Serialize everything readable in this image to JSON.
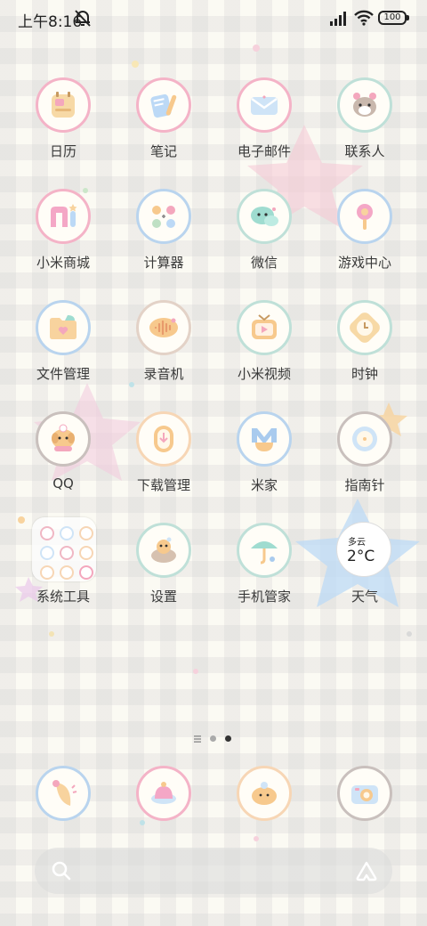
{
  "status_bar": {
    "time": "上午8:16",
    "battery": "100",
    "icons": [
      "silent-bell-icon",
      "signal-icon",
      "wifi-icon",
      "battery-icon"
    ]
  },
  "apps": [
    {
      "label": "日历",
      "icon": "calendar-icon",
      "ring": "#f4b3c7"
    },
    {
      "label": "笔记",
      "icon": "notes-icon",
      "ring": "#f4b3c7"
    },
    {
      "label": "电子邮件",
      "icon": "mail-icon",
      "ring": "#f4b3c7"
    },
    {
      "label": "联系人",
      "icon": "contacts-icon",
      "ring": "#bfe0d8"
    },
    {
      "label": "小米商城",
      "icon": "mi-store-icon",
      "ring": "#f4b3c7"
    },
    {
      "label": "计算器",
      "icon": "calculator-icon",
      "ring": "#b9d4ee"
    },
    {
      "label": "微信",
      "icon": "wechat-icon",
      "ring": "#bfe0d8"
    },
    {
      "label": "游戏中心",
      "icon": "game-center-icon",
      "ring": "#b9d4ee"
    },
    {
      "label": "文件管理",
      "icon": "file-manager-icon",
      "ring": "#b9d4ee"
    },
    {
      "label": "录音机",
      "icon": "recorder-icon",
      "ring": "#e3d2c7"
    },
    {
      "label": "小米视频",
      "icon": "video-icon",
      "ring": "#bfe0d8"
    },
    {
      "label": "时钟",
      "icon": "clock-icon",
      "ring": "#bfe0d8"
    },
    {
      "label": "QQ",
      "icon": "qq-icon",
      "ring": "#c9c0bd"
    },
    {
      "label": "下载管理",
      "icon": "download-manager-icon",
      "ring": "#f7d6b5"
    },
    {
      "label": "米家",
      "icon": "mi-home-icon",
      "ring": "#b9d4ee"
    },
    {
      "label": "指南针",
      "icon": "compass-icon",
      "ring": "#c9c0bd"
    },
    {
      "label": "系统工具",
      "icon": "system-tools-folder-icon",
      "ring": "none"
    },
    {
      "label": "设置",
      "icon": "settings-icon",
      "ring": "#bfe0d8"
    },
    {
      "label": "手机管家",
      "icon": "phone-manager-icon",
      "ring": "#bfe0d8"
    },
    {
      "label": "天气",
      "icon": "weather-widget-icon",
      "ring": "none"
    }
  ],
  "weather": {
    "condition": "多云",
    "temperature": "2°C"
  },
  "dock": [
    {
      "icon": "phone-dialer-icon",
      "ring": "#b9d4ee"
    },
    {
      "icon": "messages-icon",
      "ring": "#f4b3c7"
    },
    {
      "icon": "browser-icon",
      "ring": "#f7d6b5"
    },
    {
      "icon": "camera-icon",
      "ring": "#c9c0bd"
    }
  ],
  "pager": {
    "pages": 2,
    "current": 2
  },
  "search": {
    "icon_left": "search-icon",
    "icon_right": "assistant-icon"
  }
}
